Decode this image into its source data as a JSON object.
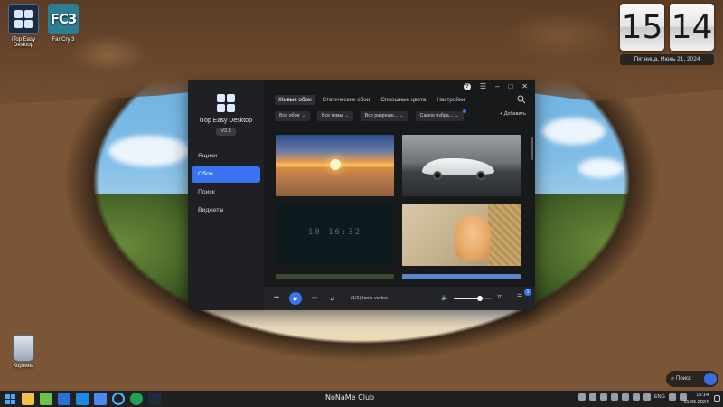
{
  "desktop": {
    "icons": [
      {
        "label": "iTop Easy Desktop"
      },
      {
        "label": "Far Cry 3",
        "tile_text": "FC3"
      }
    ],
    "recycle_bin": {
      "label": "Корзина"
    },
    "clock_widget": {
      "hours": "15",
      "minutes": "14",
      "date": "Пятница, Июнь 21, 2024"
    },
    "search_widget": {
      "placeholder": "Поиск"
    }
  },
  "app": {
    "name": "iTop Easy Desktop",
    "version": "V2.5",
    "nav": [
      {
        "label": "Ящики",
        "active": false
      },
      {
        "label": "Обои",
        "active": true
      },
      {
        "label": "Поиск",
        "active": false
      },
      {
        "label": "Виджеты",
        "active": false
      }
    ],
    "tabs": [
      {
        "label": "Живые обои",
        "active": true
      },
      {
        "label": "Статические обои",
        "active": false
      },
      {
        "label": "Сплошные цвета",
        "active": false
      },
      {
        "label": "Настройки",
        "active": false
      }
    ],
    "filters": [
      {
        "label": "Все обои"
      },
      {
        "label": "Все темы"
      },
      {
        "label": "Все разреше..."
      },
      {
        "label": "Самое избра..."
      }
    ],
    "add_label": "Добавить",
    "thumbnails": [
      {
        "name": "desert-sunset"
      },
      {
        "name": "white-sports-car"
      },
      {
        "name": "digital-clock",
        "text": "10:16:32"
      },
      {
        "name": "kitten"
      }
    ],
    "player": {
      "track": "(1/1) Ionic vortex",
      "volume": 70,
      "volume_label": "70",
      "queue_count": "1"
    },
    "accent_color": "#3a73f2"
  },
  "taskbar": {
    "center_text": "NoNaMe Club",
    "language": "ENG",
    "time": "15:14",
    "date": "21.06.2024"
  }
}
